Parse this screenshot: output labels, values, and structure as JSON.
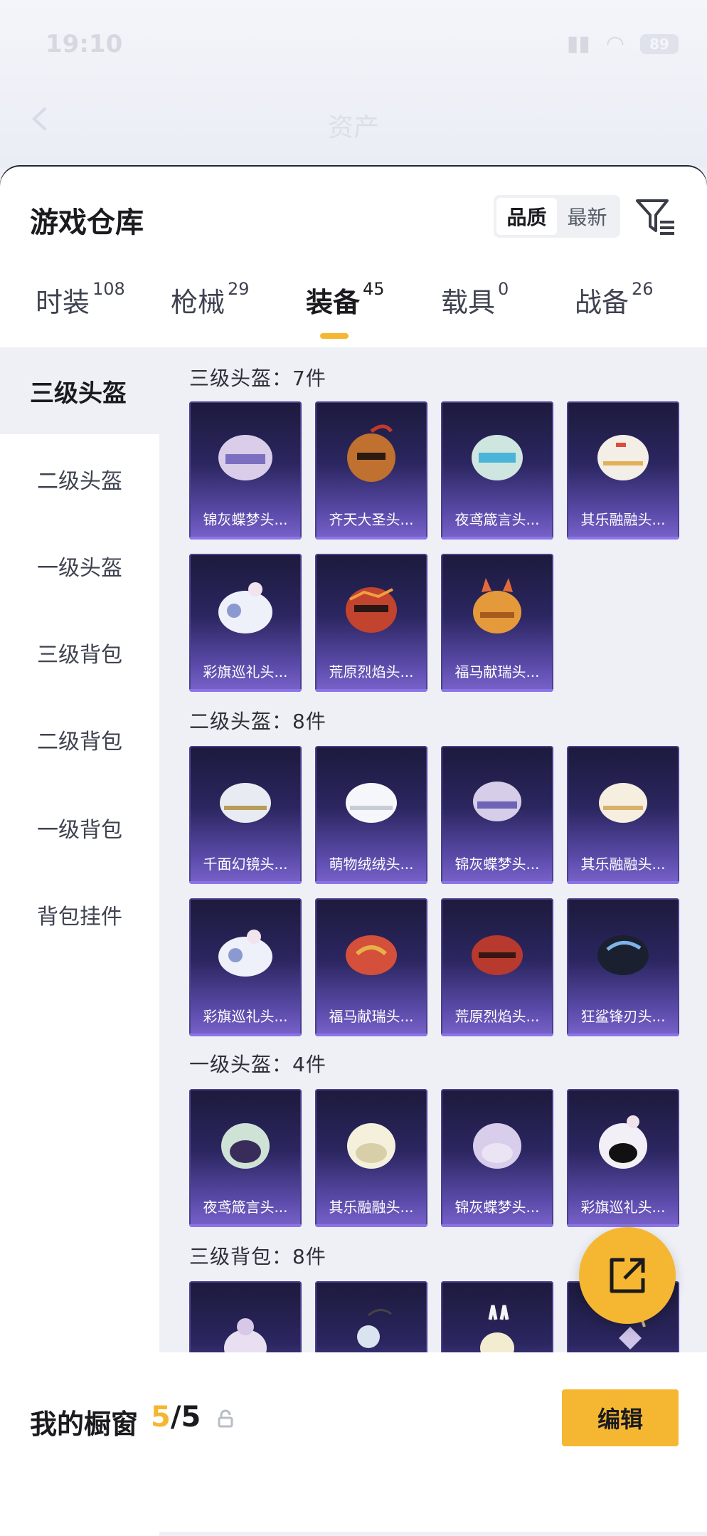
{
  "status_bar": {
    "time": "19:10",
    "battery": "89"
  },
  "header": {
    "title": "资产"
  },
  "sheet": {
    "title": "游戏仓库",
    "sort_options": [
      "品质",
      "最新"
    ],
    "tabs": [
      {
        "label": "时装",
        "count": "108"
      },
      {
        "label": "枪械",
        "count": "29"
      },
      {
        "label": "装备",
        "count": "45"
      },
      {
        "label": "载具",
        "count": "0"
      },
      {
        "label": "战备",
        "count": "26"
      }
    ]
  },
  "sidebar": {
    "items": [
      "三级头盔",
      "二级头盔",
      "一级头盔",
      "三级背包",
      "二级背包",
      "一级背包",
      "背包挂件"
    ]
  },
  "sections": [
    {
      "title": "三级头盔：7件",
      "items": [
        "锦灰蝶梦头...",
        "齐天大圣头...",
        "夜鸢箴言头...",
        "其乐融融头...",
        "彩旗巡礼头...",
        "荒原烈焰头...",
        "福马献瑞头..."
      ]
    },
    {
      "title": "二级头盔：8件",
      "items": [
        "千面幻镜头...",
        "萌物绒绒头...",
        "锦灰蝶梦头...",
        "其乐融融头...",
        "彩旗巡礼头...",
        "福马献瑞头...",
        "荒原烈焰头...",
        "狂鲨锋刃头..."
      ]
    },
    {
      "title": "一级头盔：4件",
      "items": [
        "夜鸢箴言头...",
        "其乐融融头...",
        "锦灰蝶梦头...",
        "彩旗巡礼头..."
      ]
    },
    {
      "title": "三级背包：8件",
      "items": [
        "",
        "",
        "",
        ""
      ]
    }
  ],
  "bottom": {
    "window_label": "我的橱窗",
    "current": "5",
    "separator": "/",
    "total": "5",
    "edit_label": "编辑"
  },
  "colors": {
    "accent": "#f5b731",
    "card_bg": "#2b2660"
  }
}
